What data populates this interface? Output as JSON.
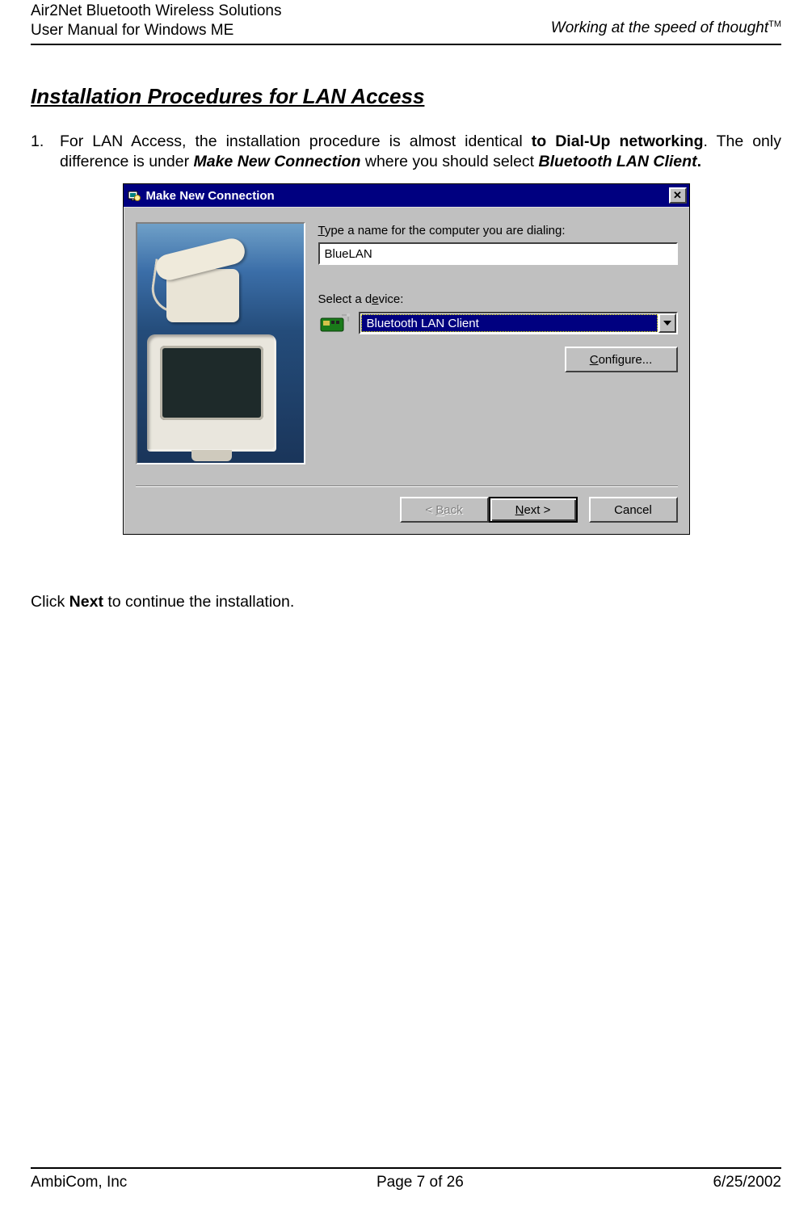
{
  "header": {
    "left_line1": "Air2Net Bluetooth Wireless Solutions",
    "left_line2": "User Manual for Windows ME",
    "right": "Working at the speed of thought",
    "tm": "TM"
  },
  "section_title": "Installation Procedures for LAN Access",
  "body": {
    "list_number": "1.",
    "seg1": "For LAN Access, the installation procedure is almost identical ",
    "seg2_bold": "to Dial-Up networking",
    "seg3": ". The only difference is under ",
    "seg4_bi": "Make New Connection",
    "seg5": " where you should select ",
    "seg6_bi": "Bluetooth LAN Client",
    "seg7_bold": "."
  },
  "dialog": {
    "title": "Make New Connection",
    "close_glyph": "✕",
    "name_label": "Type a name for the computer you are dialing:",
    "name_value": "BlueLAN",
    "device_label": "Select a device:",
    "device_selected": "Bluetooth LAN Client",
    "configure_label": "Configure...",
    "back_label": "< Back",
    "next_label": "Next >",
    "cancel_label": "Cancel"
  },
  "after": {
    "pre": "Click ",
    "bold": "Next",
    "post": " to continue the installation."
  },
  "footer": {
    "left": "AmbiCom, Inc",
    "center": "Page 7 of 26",
    "right": "6/25/2002"
  }
}
